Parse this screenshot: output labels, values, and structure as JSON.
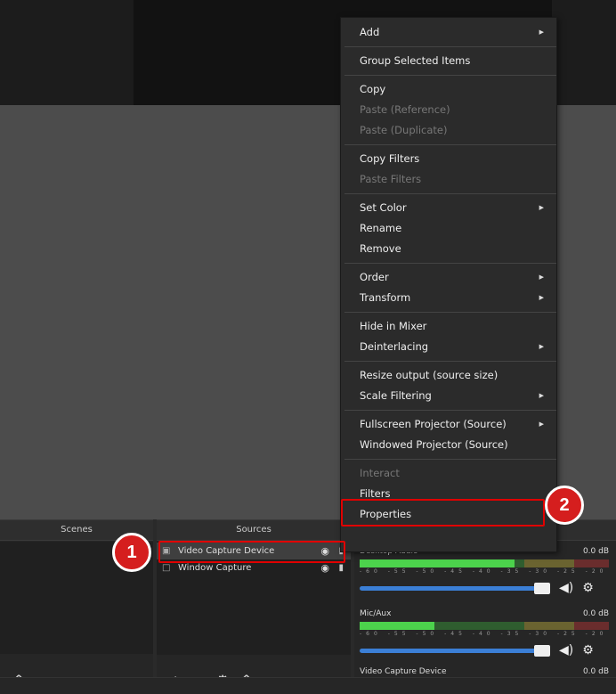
{
  "menu": {
    "items": [
      {
        "label": "Add",
        "submenu": true
      },
      {
        "sep": true
      },
      {
        "label": "Group Selected Items"
      },
      {
        "sep": true
      },
      {
        "label": "Copy"
      },
      {
        "label": "Paste (Reference)",
        "disabled": true
      },
      {
        "label": "Paste (Duplicate)",
        "disabled": true
      },
      {
        "sep": true
      },
      {
        "label": "Copy Filters"
      },
      {
        "label": "Paste Filters",
        "disabled": true
      },
      {
        "sep": true
      },
      {
        "label": "Set Color",
        "submenu": true
      },
      {
        "label": "Rename"
      },
      {
        "label": "Remove"
      },
      {
        "sep": true
      },
      {
        "label": "Order",
        "submenu": true
      },
      {
        "label": "Transform",
        "submenu": true
      },
      {
        "sep": true
      },
      {
        "label": "Hide in Mixer"
      },
      {
        "label": "Deinterlacing",
        "submenu": true
      },
      {
        "sep": true
      },
      {
        "label": "Resize output (source size)"
      },
      {
        "label": "Scale Filtering",
        "submenu": true
      },
      {
        "sep": true
      },
      {
        "label": "Fullscreen Projector (Source)",
        "submenu": true
      },
      {
        "label": "Windowed Projector (Source)"
      },
      {
        "sep": true
      },
      {
        "label": "Interact",
        "disabled": true
      },
      {
        "label": "Filters"
      },
      {
        "label": "Properties"
      }
    ]
  },
  "docks": {
    "scenes_title": "Scenes",
    "sources_title": "Sources"
  },
  "sources": [
    {
      "name": "Video Capture Device",
      "icon": "camera-icon"
    },
    {
      "name": "Window Capture",
      "icon": "window-icon"
    }
  ],
  "mixer": {
    "channels": [
      {
        "name": "Desktop Audio",
        "db": "0.0 dB",
        "level": 0.62
      },
      {
        "name": "Mic/Aux",
        "db": "0.0 dB",
        "level": 0.3
      },
      {
        "name": "Video Capture Device",
        "db": "0.0 dB"
      }
    ],
    "ticks": "-60 -55 -50 -45 -40 -35 -30 -25 -20 -15 -10 -5 0"
  },
  "annotations": {
    "badge1": "1",
    "badge2": "2"
  },
  "colors": {
    "highlight": "#e00000",
    "badge": "#d51e1e"
  }
}
